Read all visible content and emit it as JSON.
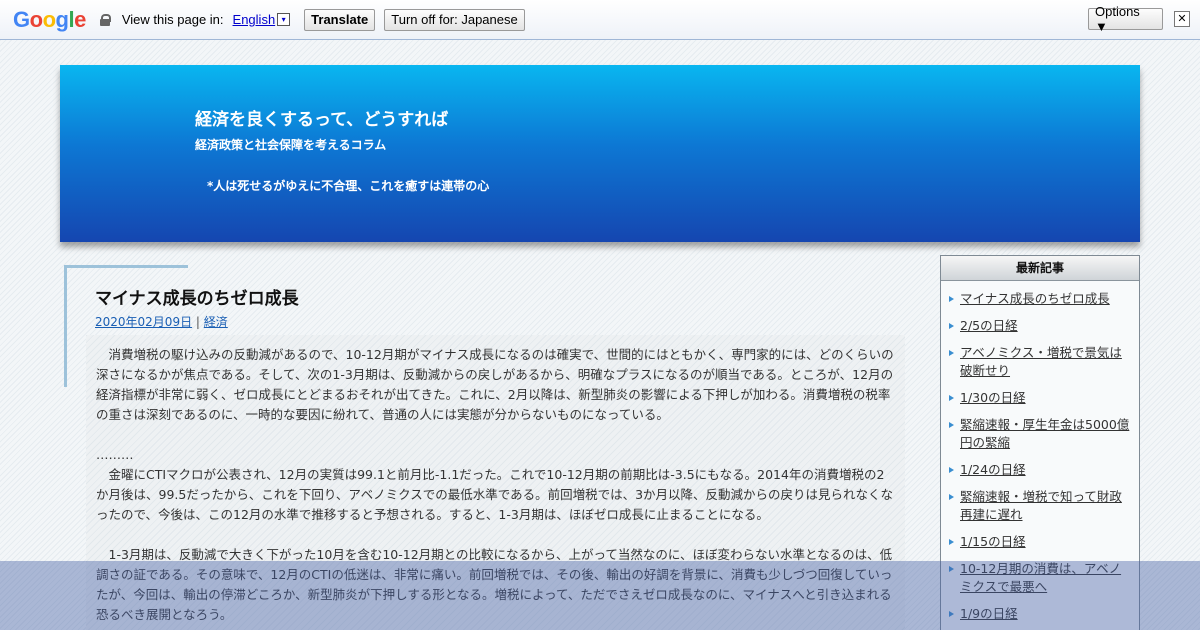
{
  "translate_bar": {
    "logo": "Google",
    "view_label": "View this page in:",
    "language": "English",
    "language_arrow": "▾",
    "translate_button": "Translate",
    "turn_off_button": "Turn off for: Japanese",
    "options_button": "Options ▼",
    "close": "✕"
  },
  "header": {
    "title": "経済を良くするって、どうすれば",
    "subtitle": "経済政策と社会保障を考えるコラム",
    "motto": "*人は死せるがゆえに不合理、これを癒すは連帯の心"
  },
  "article": {
    "title": "マイナス成長のちゼロ成長",
    "date": "2020年02月09日",
    "separator": " | ",
    "category": "経済",
    "paragraphs": [
      "消費増税の駆け込みの反動減があるので、10-12月期がマイナス成長になるのは確実で、世間的にはともかく、専門家的には、どのくらいの深さになるかが焦点である。そして、次の1-3月期は、反動減からの戻しがあるから、明確なプラスになるのが順当である。ところが、12月の経済指標が非常に弱く、ゼロ成長にとどまるおそれが出てきた。これに、2月以降は、新型肺炎の影響による下押しが加わる。消費増税の税率の重さは深刻であるのに、一時的な要因に紛れて、普通の人には実態が分からないものになっている。",
      "………",
      "金曜にCTIマクロが公表され、12月の実質は99.1と前月比-1.1だった。これで10-12月期の前期比は-3.5にもなる。2014年の消費増税の2か月後は、99.5だったから、これを下回り、アベノミクスでの最低水準である。前回増税では、3か月以降、反動減からの戻りは見られなくなったので、今後は、この12月の水準で推移すると予想される。すると、1-3月期は、ほぼゼロ成長に止まることになる。",
      "1-3月期は、反動減で大きく下がった10月を含む10-12月期との比較になるから、上がって当然なのに、ほぼ変わらない水準となるのは、低調さの証である。その意味で、12月のCTIの低迷は、非常に痛い。前回増税では、その後、輸出の好調を背景に、消費も少しづつ回復していったが、今回は、輸出の停滞どころか、新型肺炎が下押しする形となる。増税によって、ただでさえゼロ成長なのに、マイナスへと引き込まれる恐るべき展開となろう。"
    ]
  },
  "sidebar": {
    "heading": "最新記事",
    "items": [
      "マイナス成長のちゼロ成長",
      "2/5の日経",
      "アベノミクス・増税で景気は破断せり",
      "1/30の日経",
      "緊縮速報・厚生年金は5000億円の緊縮",
      "1/24の日経",
      "緊縮速報・増税で知って財政再建に遅れ",
      "1/15の日経",
      "10-12月期の消費は、アベノミクスで最悪へ",
      "1/9の日経"
    ]
  },
  "colors": {
    "header_top": "#09b6f0",
    "header_bottom": "#1546b0",
    "link": "#1a5fb4",
    "overlay": "#465fa5"
  }
}
